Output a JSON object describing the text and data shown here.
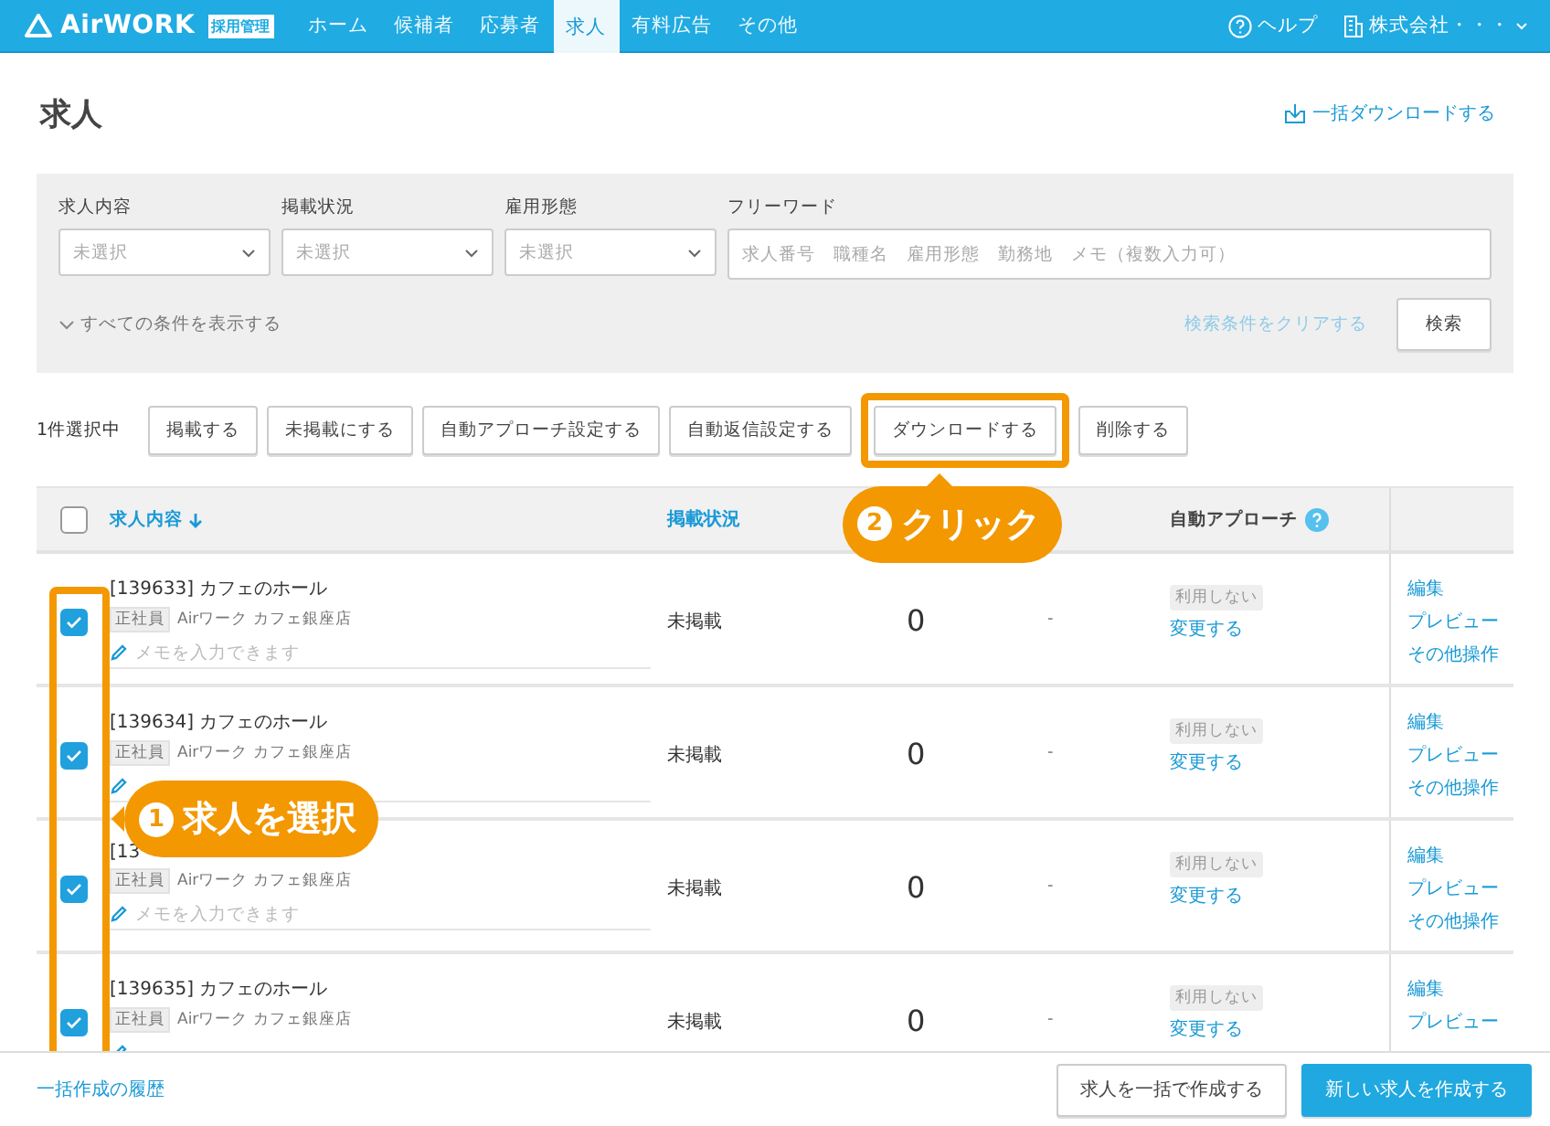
{
  "header": {
    "logo": "AirWORK",
    "logo_badge": "採用管理",
    "nav": [
      {
        "label": "ホーム",
        "selected": false
      },
      {
        "label": "候補者",
        "selected": false
      },
      {
        "label": "応募者",
        "selected": false
      },
      {
        "label": "求人",
        "selected": true
      },
      {
        "label": "有料広告",
        "selected": false
      },
      {
        "label": "その他",
        "selected": false
      }
    ],
    "help": "ヘルプ",
    "account": "株式会社・・・"
  },
  "page_title": "求人",
  "bulk_download": "一括ダウンロードする",
  "filters": {
    "fields": [
      {
        "kind": "select",
        "label": "求人内容",
        "placeholder": "未選択"
      },
      {
        "kind": "select",
        "label": "掲載状況",
        "placeholder": "未選択"
      },
      {
        "kind": "select",
        "label": "雇用形態",
        "placeholder": "未選択"
      },
      {
        "kind": "text",
        "label": "フリーワード",
        "placeholder": "求人番号　職種名　雇用形態　勤務地　メモ（複数入力可）"
      }
    ],
    "show_all": "すべての条件を表示する",
    "clear": "検索条件をクリアする",
    "search": "検索"
  },
  "selection_count": "1件選択中",
  "actions": [
    {
      "label": "掲載する",
      "highlighted": false
    },
    {
      "label": "未掲載にする",
      "highlighted": false
    },
    {
      "label": "自動アプローチ設定する",
      "highlighted": false
    },
    {
      "label": "自動返信設定する",
      "highlighted": false
    },
    {
      "label": "ダウンロードする",
      "highlighted": true
    },
    {
      "label": "削除する",
      "highlighted": false
    }
  ],
  "table": {
    "select_all_checked": false,
    "columns": [
      "求人内容",
      "掲載状況",
      "自動アプローチ"
    ],
    "rows": [
      {
        "checked": true,
        "title": "[139633] カフェのホール",
        "tag": "正社員",
        "store": "Airワーク カフェ銀座店",
        "memo": "メモを入力できます",
        "status": "未掲載",
        "count": "0",
        "column_5": "-",
        "approach": "利用しない",
        "change": "変更する",
        "links": [
          "編集",
          "プレビュー",
          "その他操作"
        ]
      },
      {
        "checked": true,
        "title": "[139634] カフェのホール",
        "tag": "正社員",
        "store": "Airワーク カフェ銀座店",
        "status": "未掲載",
        "count": "0",
        "column_5": "-",
        "approach": "利用しない",
        "change": "変更する",
        "links": [
          "編集",
          "プレビュー",
          "その他操作"
        ]
      },
      {
        "checked": true,
        "title": "[13",
        "tag": "正社員",
        "store": "Airワーク カフェ銀座店",
        "memo": "メモを入力できます",
        "status": "未掲載",
        "count": "0",
        "column_5": "-",
        "approach": "利用しない",
        "change": "変更する",
        "links": [
          "編集",
          "プレビュー",
          "その他操作"
        ]
      },
      {
        "checked": true,
        "title": "[139635] カフェのホール",
        "tag": "正社員",
        "store": "Airワーク カフェ銀座店",
        "status": "未掲載",
        "count": "0",
        "column_5": "-",
        "approach": "利用しない",
        "change": "変更する",
        "links": [
          "編集",
          "プレビュー"
        ]
      }
    ]
  },
  "annotations": [
    {
      "number": "1",
      "text": "求人を選択"
    },
    {
      "number": "2",
      "text": "クリック"
    }
  ],
  "footer": {
    "history": "一括作成の履歴",
    "bulk_create": "求人を一括で作成する",
    "create": "新しい求人を作成する"
  }
}
